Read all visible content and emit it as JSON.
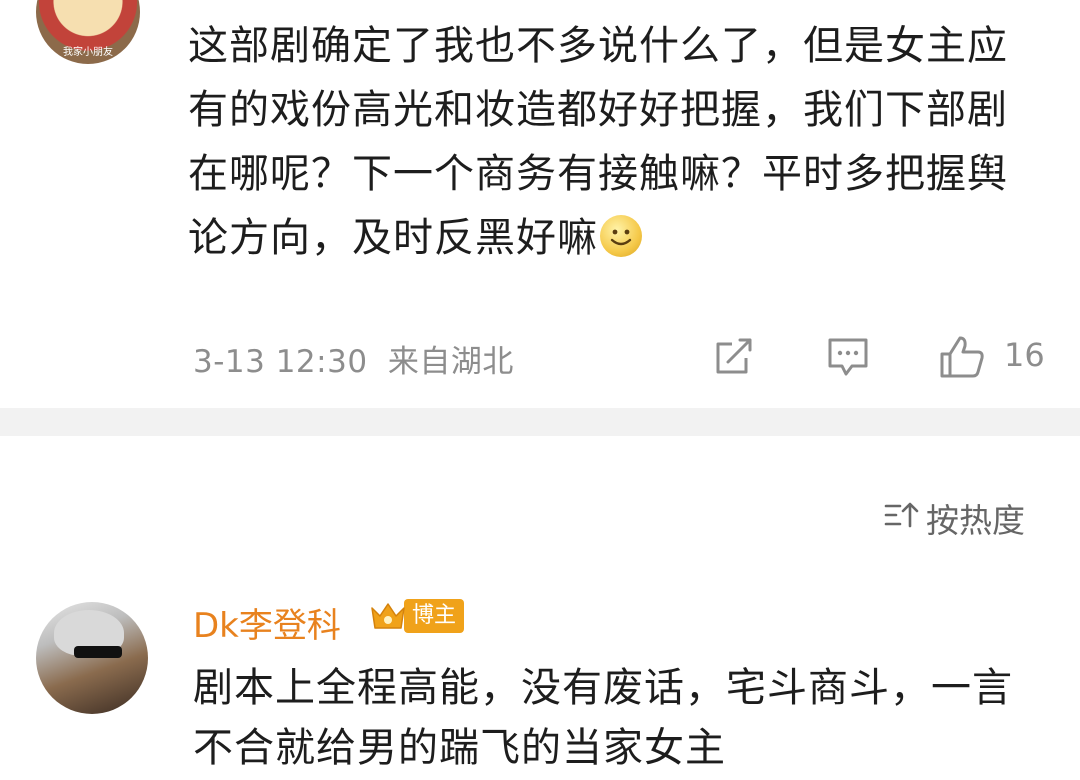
{
  "post": {
    "avatar_caption": "我家小朋友",
    "text": "这部剧确定了我也不多说什么了，但是女主应有的戏份高光和妆造都好好把握，我们下部剧在哪呢？下一个商务有接触嘛？平时多把握舆论方向，及时反黑好嘛",
    "emoji": "smiley-emoji",
    "time": "3-13 12:30",
    "location": "来自湖北",
    "like_count": "16"
  },
  "sort": {
    "label": "按热度",
    "icon": "sort-icon"
  },
  "comment": {
    "username": "Dk李登科",
    "badge": "博主",
    "text": "剧本上全程高能，没有废话，宅斗商斗，一言不合就给男的踹飞的当家女主"
  },
  "colors": {
    "username": "#e8821e",
    "badge": "#f0a21a",
    "meta": "#8d8d8d",
    "divider": "#f2f2f2"
  }
}
